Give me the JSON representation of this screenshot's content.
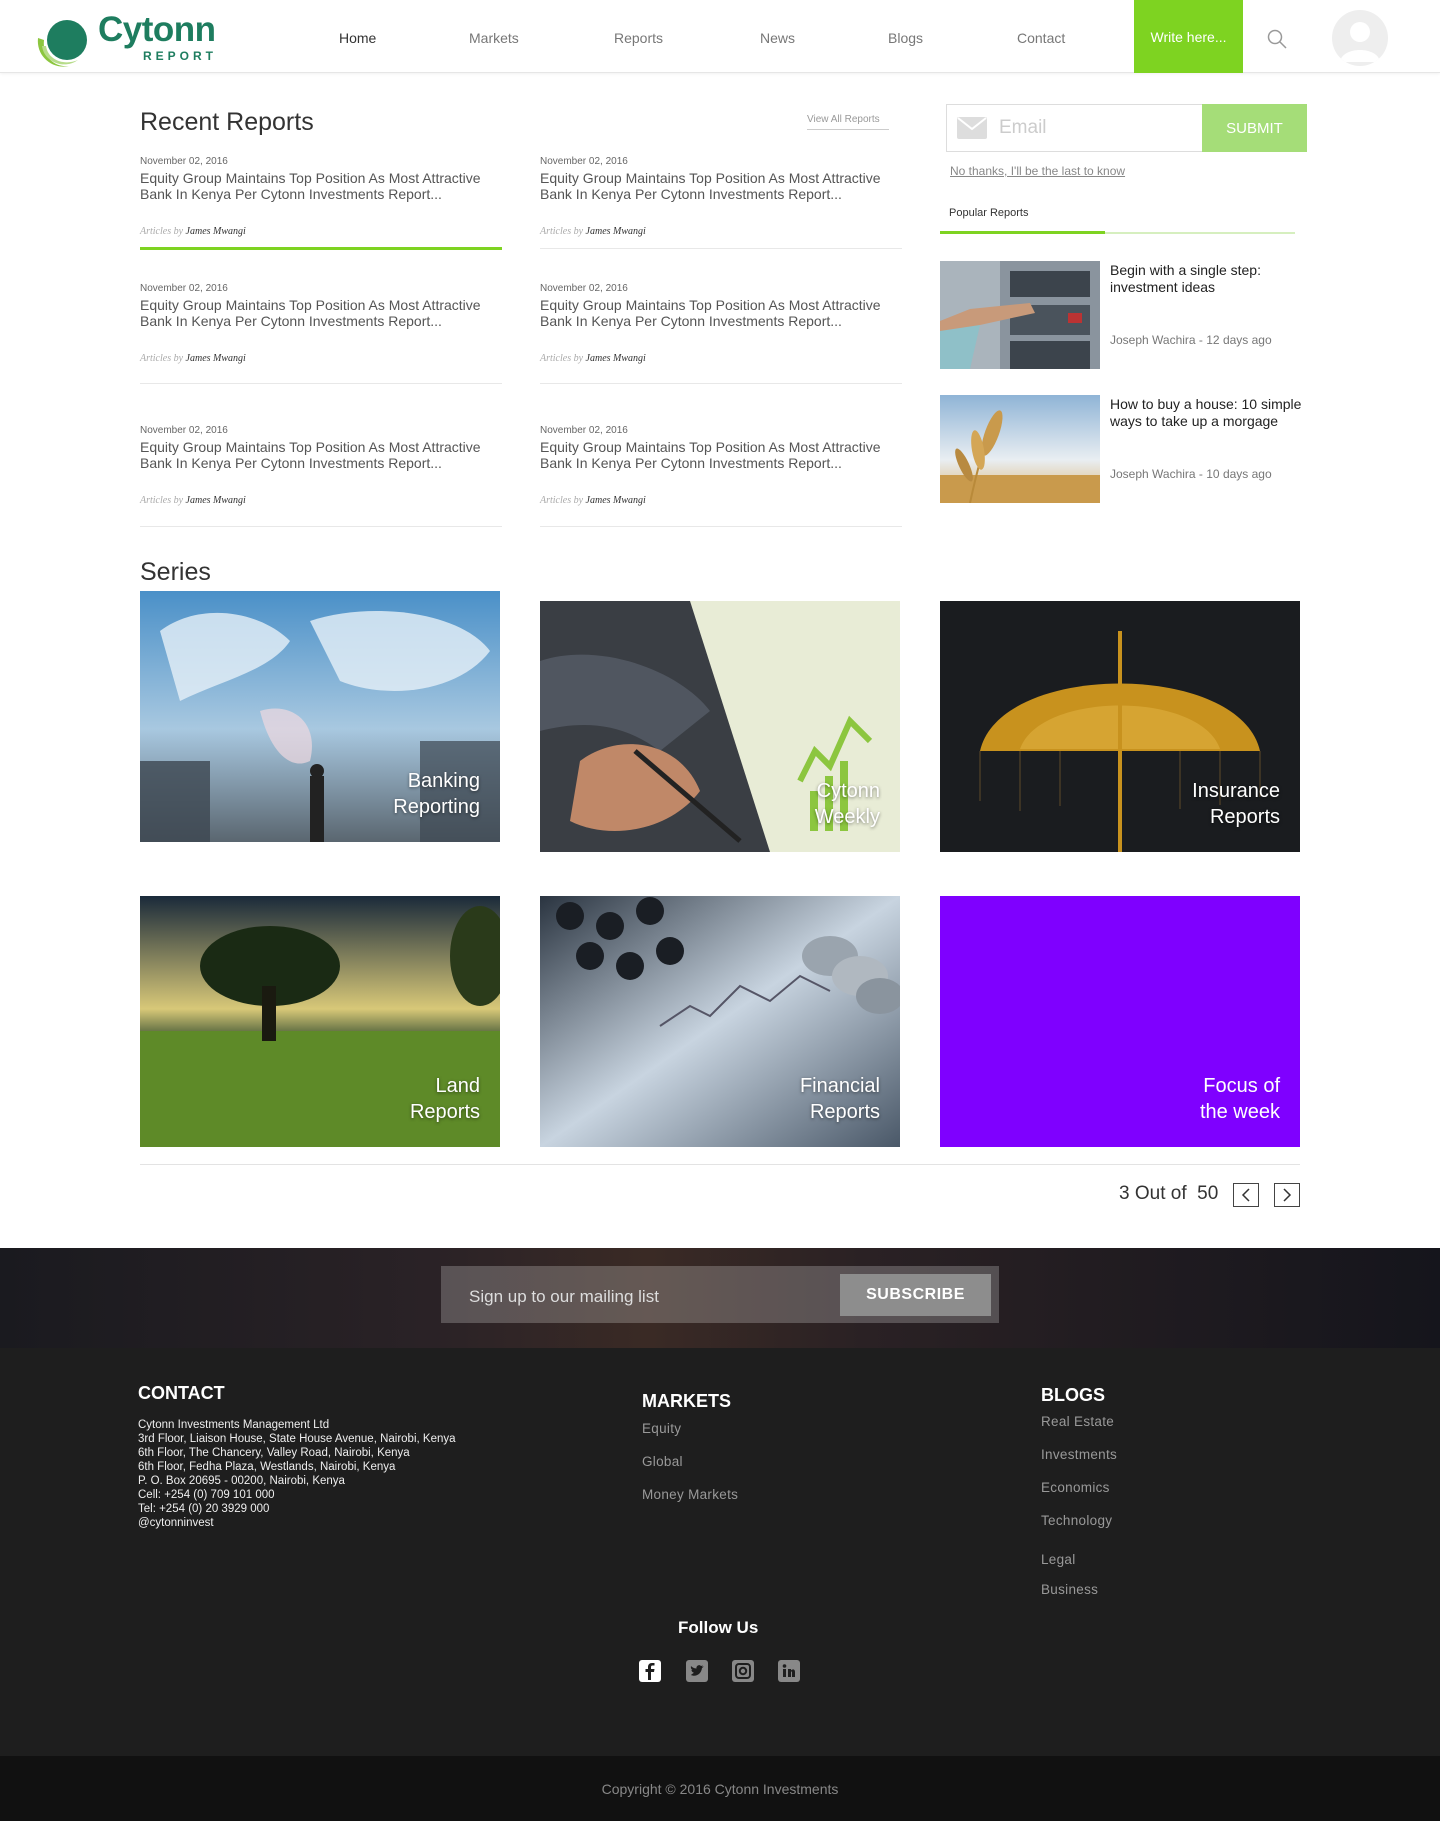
{
  "brand": {
    "title": "Cytonn",
    "subtitle": "REPORT",
    "color": "#1e7d5f",
    "accent": "#7ed321"
  },
  "nav": {
    "items": [
      "Home",
      "Markets",
      "Reports",
      "News",
      "Blogs",
      "Contact"
    ],
    "active": "Home",
    "write_label": "Write here..."
  },
  "recent": {
    "heading": "Recent Reports",
    "view_all": "View All Reports",
    "reports": [
      {
        "date": "November 02, 2016",
        "title": "Equity Group Maintains Top Position As Most Attractive Bank In Kenya Per Cytonn Investments Report...",
        "by": "Articles by",
        "author": "James Mwangi"
      },
      {
        "date": "November 02, 2016",
        "title": "Equity Group Maintains Top Position As Most Attractive Bank In Kenya Per Cytonn Investments Report...",
        "by": "Articles by",
        "author": "James Mwangi"
      },
      {
        "date": "November 02, 2016",
        "title": "Equity Group Maintains Top Position As Most Attractive Bank In Kenya Per Cytonn Investments Report...",
        "by": "Articles by",
        "author": "James Mwangi"
      },
      {
        "date": "November 02, 2016",
        "title": "Equity Group Maintains Top Position As Most Attractive Bank In Kenya Per Cytonn Investments Report...",
        "by": "Articles by",
        "author": "James Mwangi"
      },
      {
        "date": "November 02, 2016",
        "title": "Equity Group Maintains Top Position As Most Attractive Bank In Kenya Per Cytonn Investments Report...",
        "by": "Articles by",
        "author": "James Mwangi"
      },
      {
        "date": "November 02, 2016",
        "title": "Equity Group Maintains Top Position As Most Attractive Bank In Kenya Per Cytonn Investments Report...",
        "by": "Articles by",
        "author": "James Mwangi"
      }
    ]
  },
  "sidebar": {
    "email_placeholder": "Email",
    "submit": "SUBMIT",
    "no_thanks": "No thanks, I'll be the last to know",
    "popular_label": "Popular Reports",
    "popular": [
      {
        "title": "Begin with a single step: investment ideas",
        "meta": "Joseph Wachira - 12 days ago"
      },
      {
        "title": "How to buy a house: 10 simple ways to take up a morgage",
        "meta": "Joseph Wachira - 10 days ago"
      }
    ]
  },
  "series": {
    "heading": "Series",
    "tiles": [
      {
        "line1": "Banking",
        "line2": "Reporting"
      },
      {
        "line1": "Cytonn",
        "line2": "Weekly"
      },
      {
        "line1": "Insurance",
        "line2": "Reports"
      },
      {
        "line1": "Land",
        "line2": "Reports"
      },
      {
        "line1": "Financial",
        "line2": "Reports"
      },
      {
        "line1": "Focus of",
        "line2": "the week"
      }
    ],
    "focus_color": "#7f00ff",
    "pager": {
      "current": "3",
      "out_of": "Out of",
      "total": "50"
    }
  },
  "subscribe": {
    "placeholder": "Sign up to our mailing list",
    "button": "SUBSCRIBE"
  },
  "footer": {
    "contact_heading": "CONTACT",
    "contact_lines": [
      "Cytonn Investments Management Ltd",
      "3rd Floor, Liaison House, State House Avenue, Nairobi, Kenya",
      "6th Floor, The Chancery, Valley Road, Nairobi, Kenya",
      "6th Floor, Fedha Plaza, Westlands, Nairobi, Kenya",
      "P. O. Box 20695 - 00200, Nairobi, Kenya",
      "Cell: +254 (0) 709 101 000",
      "Tel: +254 (0) 20 3929 000",
      "@cytonninvest"
    ],
    "markets_heading": "MARKETS",
    "markets": [
      "Equity",
      "Global",
      "Money Markets"
    ],
    "blogs_heading": "BLOGS",
    "blogs": [
      "Real Estate",
      "Investments",
      "Economics",
      "Technology",
      "Legal",
      "Business"
    ],
    "follow": "Follow Us",
    "social": [
      "facebook-icon",
      "twitter-icon",
      "instagram-icon",
      "linkedin-icon"
    ],
    "copyright": "Copyright © 2016 Cytonn Investments"
  }
}
